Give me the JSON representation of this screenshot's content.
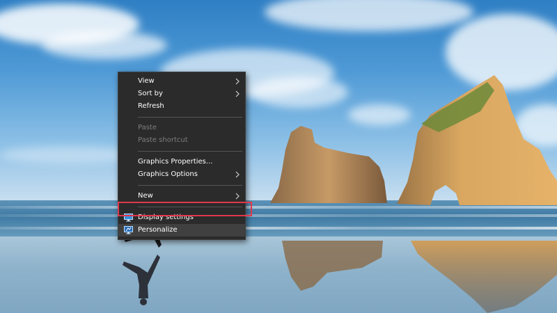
{
  "wallpaper": {
    "icon": "windows-10-hero-beach-wallpaper"
  },
  "context_menu": {
    "groups": [
      {
        "items": [
          {
            "label": "View",
            "submenu": true,
            "enabled": true
          },
          {
            "label": "Sort by",
            "submenu": true,
            "enabled": true
          },
          {
            "label": "Refresh",
            "submenu": false,
            "enabled": true
          }
        ]
      },
      {
        "items": [
          {
            "label": "Paste",
            "submenu": false,
            "enabled": false
          },
          {
            "label": "Paste shortcut",
            "submenu": false,
            "enabled": false
          }
        ]
      },
      {
        "items": [
          {
            "label": "Graphics Properties...",
            "submenu": false,
            "enabled": true
          },
          {
            "label": "Graphics Options",
            "submenu": true,
            "enabled": true
          }
        ]
      },
      {
        "items": [
          {
            "label": "New",
            "submenu": true,
            "enabled": true
          }
        ]
      },
      {
        "items": [
          {
            "label": "Display settings",
            "submenu": false,
            "enabled": true,
            "icon": "display-settings-icon"
          },
          {
            "label": "Personalize",
            "submenu": false,
            "enabled": true,
            "icon": "personalize-icon",
            "highlighted": true
          }
        ]
      }
    ]
  },
  "annotation": {
    "highlight_color": "#e0384b",
    "target": "Personalize"
  },
  "colors": {
    "menu_bg": "#2b2b2b",
    "menu_text": "#ffffff",
    "menu_disabled": "#7d7d7d",
    "menu_hover": "#404040"
  }
}
